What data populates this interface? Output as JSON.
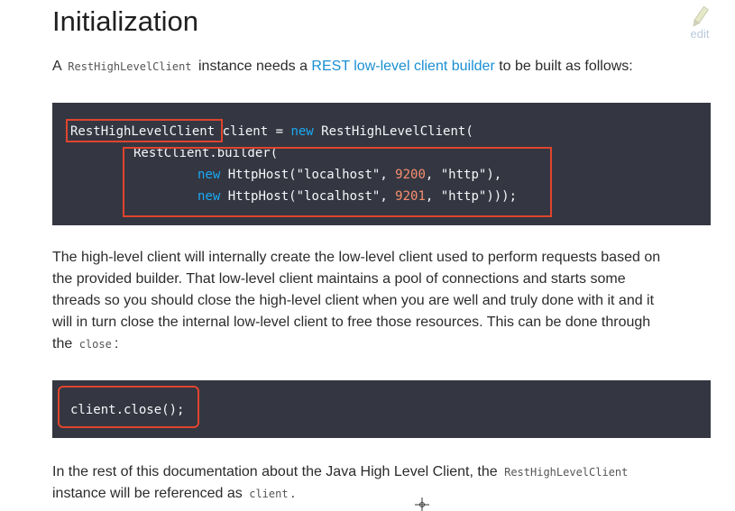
{
  "page": {
    "title": "Initialization",
    "edit_label": "edit"
  },
  "intro": {
    "prefix": "A",
    "class_name": "RestHighLevelClient",
    "middle": "instance needs a",
    "link_text": "REST low-level client builder",
    "suffix": "to be built as follows:"
  },
  "code1": {
    "line1": {
      "type": "RestHighLevelClient",
      "rest": " client = ",
      "new_kw": "new",
      "ctor": " RestHighLevelClient("
    },
    "line2": {
      "text": "RestClient.builder("
    },
    "line3": {
      "new_kw": "new",
      "host": " HttpHost(",
      "host_str": "\"localhost\"",
      "sep1": ", ",
      "port": "9200",
      "sep2": ", ",
      "scheme": "\"http\"",
      "end": "),"
    },
    "line4": {
      "new_kw": "new",
      "host": " HttpHost(",
      "host_str": "\"localhost\"",
      "sep1": ", ",
      "port": "9201",
      "sep2": ", ",
      "scheme": "\"http\"",
      "end": ")));"
    }
  },
  "body": {
    "line1": "The high-level client will internally create the low-level client used to perform requests based on",
    "line2": "the provided builder. That low-level client maintains a pool of connections and starts some",
    "line3": "threads so you should close the high-level client when you are well and truly done with it and it",
    "line4": "will in turn close the internal low-level client to free those resources. This can be done through",
    "line5_prefix": "the",
    "line5_code": "close",
    "line5_suffix": ":"
  },
  "code2": {
    "text": "client.close();"
  },
  "outro": {
    "prefix": "In the rest of this documentation about the Java High Level Client, the",
    "class_name": "RestHighLevelClient",
    "line2_prefix": "instance will be referenced as",
    "var_name": "client",
    "line2_suffix": "."
  },
  "colors": {
    "code_bg": "#343741",
    "keyword": "#1ba9f5",
    "number": "#f98f6f",
    "highlight": "#e0442e",
    "link": "#1a8fd2"
  }
}
